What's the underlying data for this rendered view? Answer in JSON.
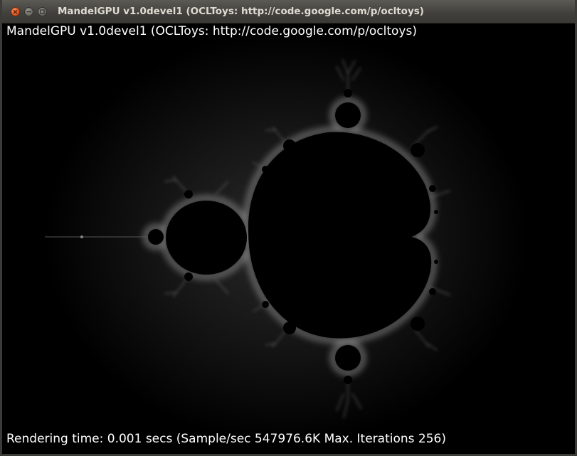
{
  "window": {
    "title": "MandelGPU v1.0devel1 (OCLToys: http://code.google.com/p/ocltoys)",
    "controls": {
      "close_icon": "close-icon",
      "minimize_icon": "minimize-icon",
      "maximize_icon": "maximize-icon"
    }
  },
  "canvas": {
    "heading": "MandelGPU v1.0devel1 (OCLToys: http://code.google.com/p/ocltoys)",
    "status": "Rendering time: 0.001 secs (Sample/sec 547976.6K Max. Iterations 256)",
    "max_iterations": 256,
    "background_color": "#000000",
    "glow_color": "#ffffff"
  }
}
